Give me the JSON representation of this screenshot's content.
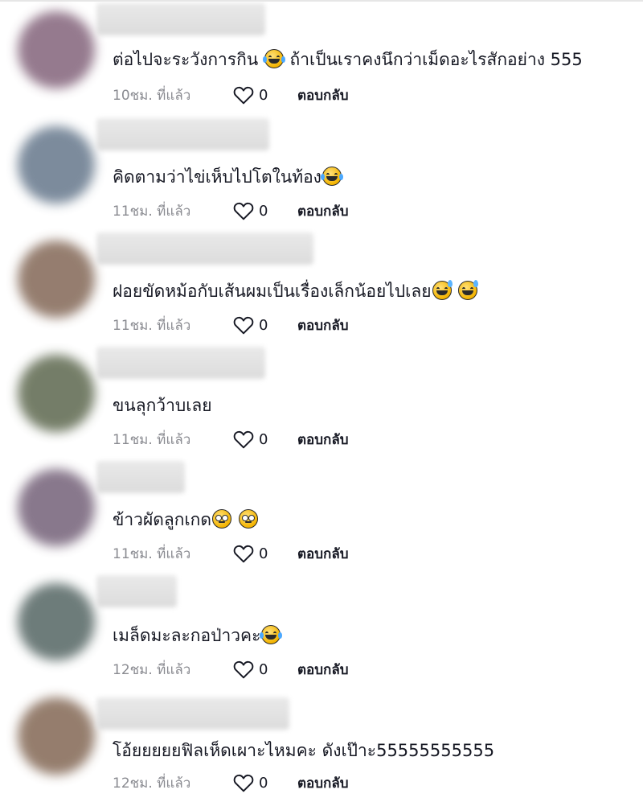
{
  "comments": [
    {
      "text": "ต่อไปจะระวังการกิน",
      "emoji_after": "😂",
      "text2": " ถ้าเป็นเราคงนึกว่าเม็ดอะไรสักอย่าง 555",
      "time": "10ชม. ที่แล้ว",
      "likes": "0",
      "reply": "ตอบกลับ",
      "avatar_color": "#8a6c82"
    },
    {
      "text": "คิดตามว่าไข่เห็บไปโตในท้อง",
      "time": "11ชม. ที่แล้ว",
      "likes": "0",
      "reply": "ตอบกลับ",
      "avatar_color": "#6e7f92"
    },
    {
      "text": "ฝอยขัดหม้อกับเส้นผมเป็นเรื่องเล็กน้อยไปเลย",
      "time": "11ชม. ที่แล้ว",
      "likes": "0",
      "reply": "ตอบกลับ",
      "avatar_color": "#8a7060"
    },
    {
      "text": "ขนลุกว้าบเลย",
      "time": "11ชม. ที่แล้ว",
      "likes": "0",
      "reply": "ตอบกลับ",
      "avatar_color": "#667058"
    },
    {
      "text": "ข้าวผัดลูกเกด",
      "time": "11ชม. ที่แล้ว",
      "likes": "0",
      "reply": "ตอบกลับ",
      "avatar_color": "#7c6a80"
    },
    {
      "text": "เมล็ดมะละกอป่าวคะ",
      "time": "12ชม. ที่แล้ว",
      "likes": "0",
      "reply": "ตอบกลับ",
      "avatar_color": "#5e6e6c"
    },
    {
      "text": "โอ้ยยยยยฟิลเห็ดเผาะไหมคะ ดังเป๊าะ55555555555",
      "time": "12ชม. ที่แล้ว",
      "likes": "0",
      "reply": "ตอบกลับ",
      "avatar_color": "#8a705e"
    }
  ],
  "icons": {
    "like": "heart-outline-icon",
    "emoji_tears": "face-with-tears-of-joy-icon",
    "emoji_sweat": "grinning-face-with-sweat-icon",
    "emoji_flushed": "flushed-face-icon"
  }
}
